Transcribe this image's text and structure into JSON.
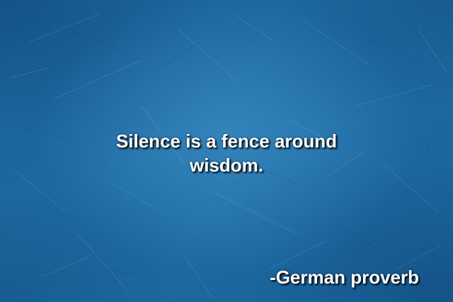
{
  "quote": {
    "text": "Silence is a fence around wisdom.",
    "attribution": "-German proverb"
  },
  "colors": {
    "background": "#1e6ea6",
    "text": "#ffffff"
  }
}
